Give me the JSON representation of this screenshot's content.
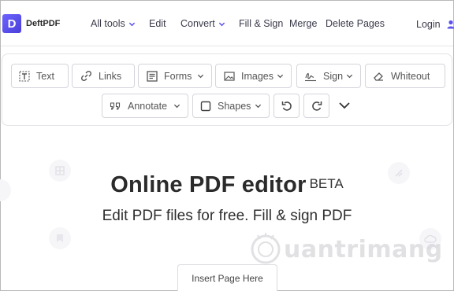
{
  "brand": {
    "logo_letter": "D",
    "name": "DeftPDF",
    "accent": "#5b52f0"
  },
  "nav": {
    "all_tools": "All tools",
    "edit": "Edit",
    "convert": "Convert",
    "fill_sign": "Fill & Sign",
    "merge": "Merge",
    "delete_pages": "Delete Pages",
    "login": "Login"
  },
  "toolbar": {
    "text": "Text",
    "links": "Links",
    "forms": "Forms",
    "images": "Images",
    "sign": "Sign",
    "whiteout": "Whiteout",
    "annotate": "Annotate",
    "shapes": "Shapes"
  },
  "hero": {
    "title": "Online PDF editor",
    "badge": "BETA",
    "subtitle": "Edit PDF files for free. Fill & sign PDF"
  },
  "insert_page": "Insert Page Here",
  "watermark": "uantrimang"
}
